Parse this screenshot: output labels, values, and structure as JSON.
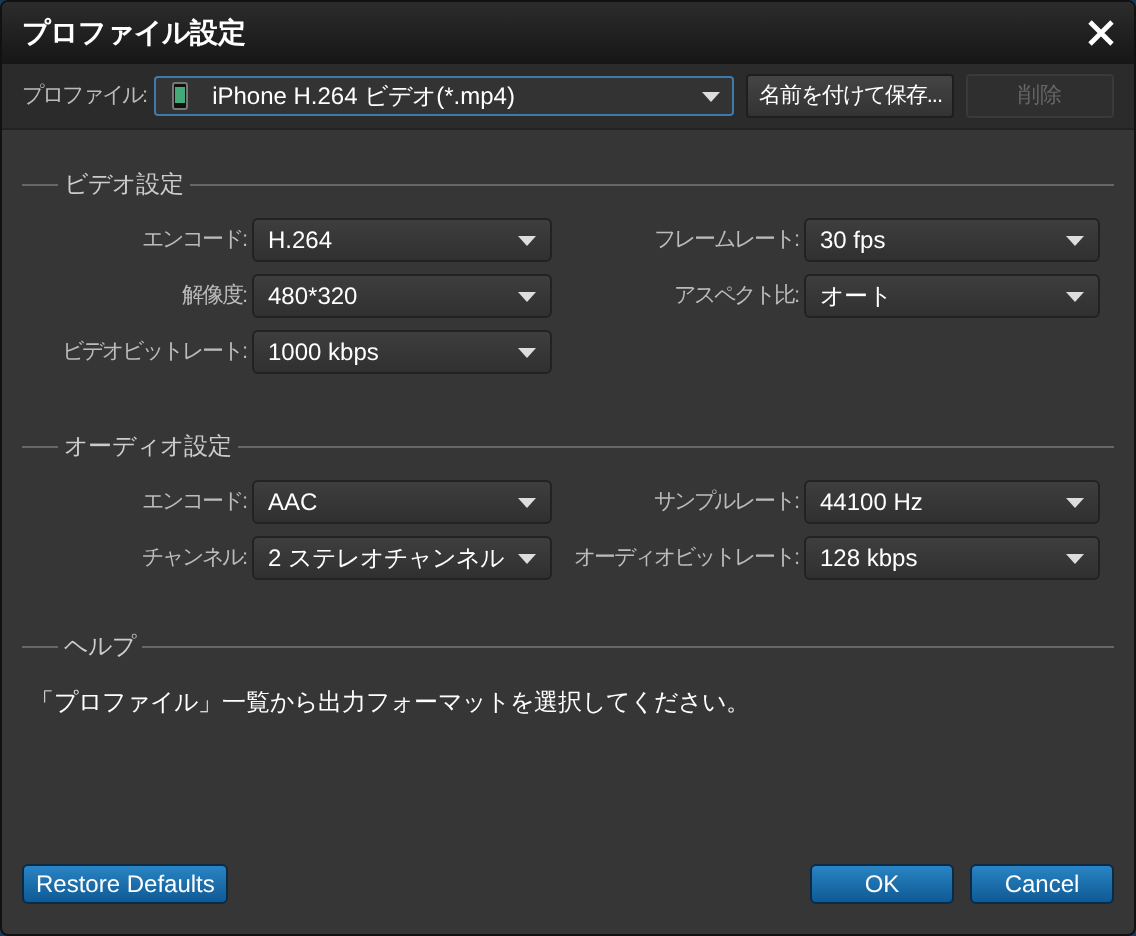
{
  "window": {
    "title": "プロファイル設定"
  },
  "profile": {
    "label": "プロファイル:",
    "value": "iPhone H.264 ビデオ(*.mp4)"
  },
  "profile_buttons": [
    {
      "label": "名前を付けて保存...",
      "disabled": false
    },
    {
      "label": "削除",
      "disabled": true
    }
  ],
  "sections": [
    {
      "title": "ビデオ設定",
      "fields": [
        {
          "label": "エンコード:",
          "value": "H.264"
        },
        {
          "label": "フレームレート:",
          "value": "30 fps"
        },
        {
          "label": "解像度:",
          "value": "480*320"
        },
        {
          "label": "アスペクト比:",
          "value": "オート"
        },
        {
          "label": "ビデオビットレート:",
          "value": "1000 kbps"
        }
      ]
    },
    {
      "title": "オーディオ設定",
      "fields": [
        {
          "label": "エンコード:",
          "value": "AAC"
        },
        {
          "label": "サンプルレート:",
          "value": "44100 Hz"
        },
        {
          "label": "チャンネル:",
          "value": "2 ステレオチャンネル"
        },
        {
          "label": "オーディオビットレート:",
          "value": "128 kbps"
        }
      ]
    }
  ],
  "help": {
    "title": "ヘルプ",
    "text": "「プロファイル」一覧から出力フォーマットを選択してください。"
  },
  "footer_buttons": [
    {
      "label": "Restore Defaults",
      "kind": "left"
    },
    {
      "label": "OK",
      "kind": "right"
    },
    {
      "label": "Cancel",
      "kind": "right"
    }
  ]
}
